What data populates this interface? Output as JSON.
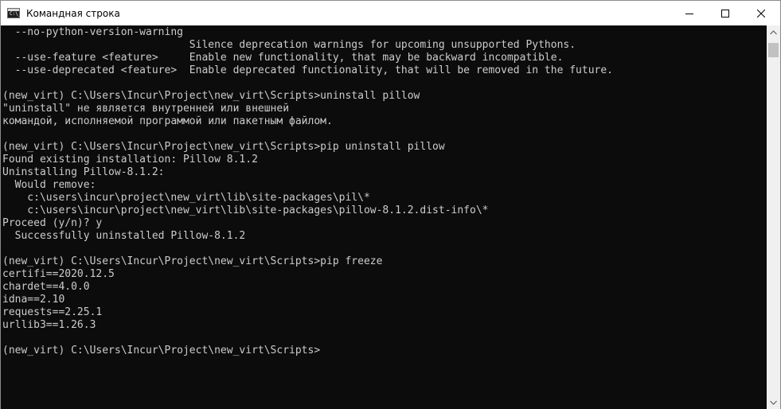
{
  "window": {
    "title": "Командная строка",
    "icon": "cmd-icon",
    "icon_prompt": "C:\\_",
    "controls": [
      "minimize-icon",
      "maximize-icon",
      "close-icon"
    ]
  },
  "console": {
    "background": "#0c0c0c",
    "foreground": "#cccccc",
    "lines": [
      "  --no-python-version-warning",
      "                              Silence deprecation warnings for upcoming unsupported Pythons.",
      "  --use-feature <feature>     Enable new functionality, that may be backward incompatible.",
      "  --use-deprecated <feature>  Enable deprecated functionality, that will be removed in the future.",
      "",
      "(new_virt) C:\\Users\\Incur\\Project\\new_virt\\Scripts>uninstall pillow",
      "\"uninstall\" не является внутренней или внешней",
      "командой, исполняемой программой или пакетным файлом.",
      "",
      "(new_virt) C:\\Users\\Incur\\Project\\new_virt\\Scripts>pip uninstall pillow",
      "Found existing installation: Pillow 8.1.2",
      "Uninstalling Pillow-8.1.2:",
      "  Would remove:",
      "    c:\\users\\incur\\project\\new_virt\\lib\\site-packages\\pil\\*",
      "    c:\\users\\incur\\project\\new_virt\\lib\\site-packages\\pillow-8.1.2.dist-info\\*",
      "Proceed (y/n)? y",
      "  Successfully uninstalled Pillow-8.1.2",
      "",
      "(new_virt) C:\\Users\\Incur\\Project\\new_virt\\Scripts>pip freeze",
      "certifi==2020.12.5",
      "chardet==4.0.0",
      "idna==2.10",
      "requests==2.25.1",
      "urllib3==1.26.3",
      "",
      "(new_virt) C:\\Users\\Incur\\Project\\new_virt\\Scripts>"
    ]
  },
  "scrollbar": {
    "up_icon": "scroll-up-arrow-icon",
    "down_icon": "scroll-down-arrow-icon"
  }
}
